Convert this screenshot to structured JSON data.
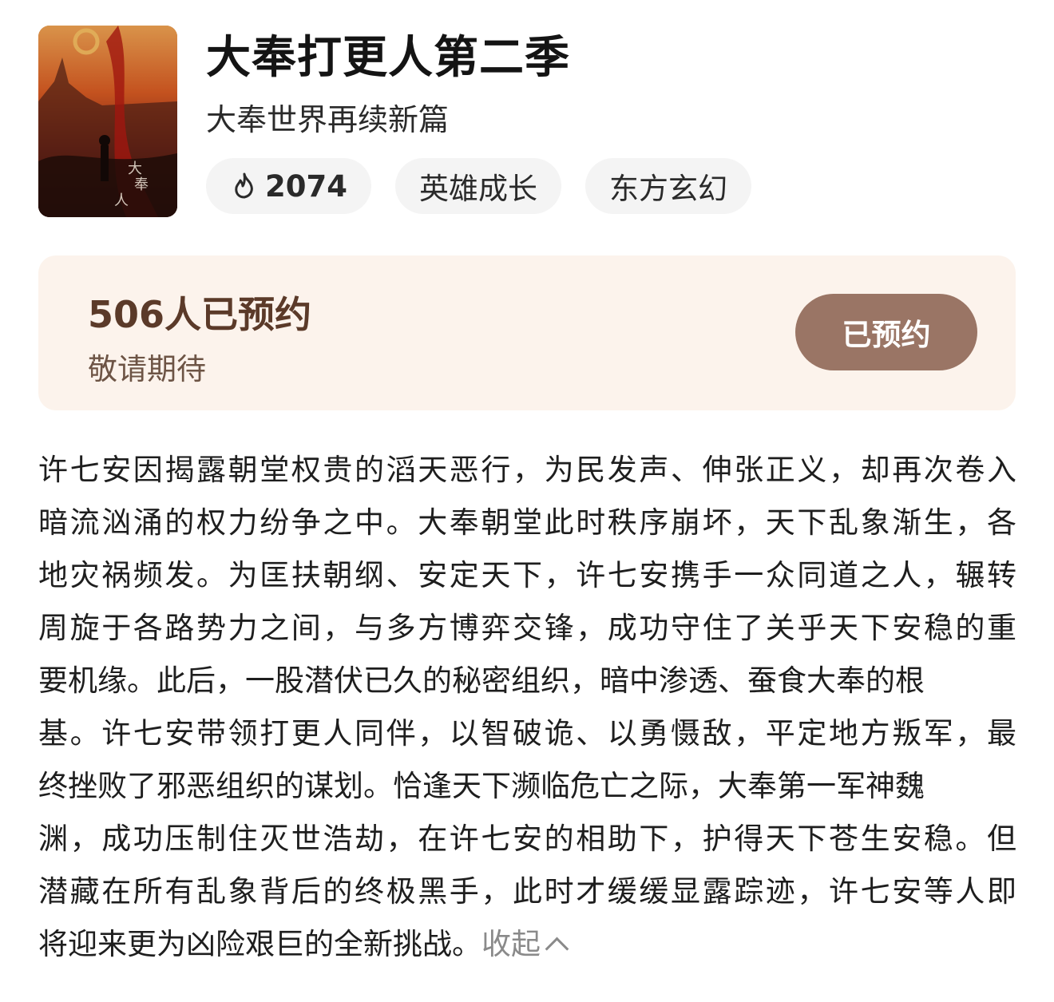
{
  "show": {
    "title": "大奉打更人第二季",
    "subtitle": "大奉世界再续新篇",
    "heat": "2074",
    "tags": [
      "英雄成长",
      "东方玄幻"
    ]
  },
  "reservation": {
    "count_text": "506人已预约",
    "sub_text": "敬请期待",
    "button_label": "已预约"
  },
  "description": {
    "lines": [
      "许七安因揭露朝堂权贵的滔天恶行，为民发声、伸张正义，却再次卷入",
      "暗流汹涌的权力纷争之中。大奉朝堂此时秩序崩坏，天下乱象渐生，各",
      "地灾祸频发。为匡扶朝纲、安定天下，许七安携手一众同道之人，辗转",
      "周旋于各路势力之间，与多方博弈交锋，成功守住了关乎天下安稳的重",
      "要机缘。此后，一股潜伏已久的秘密组织，暗中渗透、蚕食大奉的根",
      "基。许七安带领打更人同伴，以智破诡、以勇慑敌，平定地方叛军，最",
      "终挫败了邪恶组织的谋划。恰逢天下濒临危亡之际，大奉第一军神魏",
      "渊，成功压制住灭世浩劫，在许七安的相助下，护得天下苍生安稳。但",
      "潜藏在所有乱象背后的终极黑手，此时才缓缓显露踪迹，许七安等人即",
      "将迎来更为凶险艰巨的全新挑战。"
    ],
    "collapse_label": "收起"
  },
  "icons": {
    "heat": "flame-icon",
    "collapse": "chevron-up-icon"
  },
  "colors": {
    "card_bg": "#fcf3ec",
    "button_bg": "#9a7565",
    "count_text": "#5b3a29"
  }
}
